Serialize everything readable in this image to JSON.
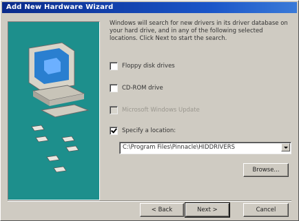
{
  "window": {
    "title": "Add New Hardware Wizard"
  },
  "intro_text": "Windows will search for new drivers in its driver database on your hard drive, and in any of the following selected locations. Click Next to start the search.",
  "options": [
    {
      "label": "Floppy disk drives",
      "checked": false,
      "enabled": true
    },
    {
      "label": "CD-ROM drive",
      "checked": false,
      "enabled": true
    },
    {
      "label": "Microsoft Windows Update",
      "checked": false,
      "enabled": false
    },
    {
      "label": "Specify a location:",
      "checked": true,
      "enabled": true
    }
  ],
  "location": {
    "value": "C:\\Program Files\\Pinnacle\\HIDDRIVERS"
  },
  "buttons": {
    "browse": "Browse...",
    "back": "< Back",
    "next": "Next >",
    "cancel": "Cancel"
  },
  "colors": {
    "graphic_bg": "#1d8f8c",
    "titlebar": "#1a55c8"
  },
  "icons": {
    "wizard_graphic": "computer-with-floppy-disks"
  }
}
